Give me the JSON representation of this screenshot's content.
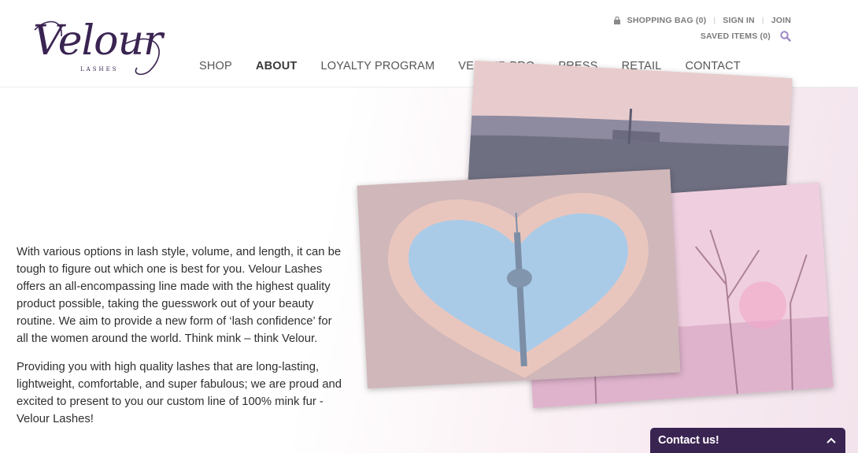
{
  "brand": {
    "logo_script": "Velour",
    "logo_sub": "LASHES",
    "color": "#3a2452"
  },
  "utility": {
    "shopping_bag": "SHOPPING BAG (0)",
    "sign_in": "SIGN IN",
    "join": "JOIN",
    "saved_items": "SAVED ITEMS (0)",
    "icons": [
      "lock-icon",
      "search-icon"
    ],
    "search_icon_color": "#9b86c4"
  },
  "nav": {
    "items": [
      {
        "label": "SHOP"
      },
      {
        "label": "ABOUT",
        "active": true
      },
      {
        "label": "LOYALTY PROGRAM"
      },
      {
        "label": "VELOUR PRO"
      },
      {
        "label": "PRESS"
      },
      {
        "label": "RETAIL"
      },
      {
        "label": "CONTACT"
      }
    ]
  },
  "content": {
    "paragraph_1": "With various options in lash style, volume, and length, it can be tough to figure out which one is best for you. Velour Lashes offers an all-encompassing line made with the highest quality product possible, taking the guesswork out of your beauty routine. We aim to provide a new form of ‘lash confidence’ for all the women around the world. Think mink – think Velour.",
    "paragraph_2": "Providing you with high quality lashes that are long-lasting, lightweight, comfortable, and super fabulous; we are proud and excited to present to you our custom line of 100% mink fur - Velour Lashes!"
  },
  "contact": {
    "label": "Contact us!",
    "icon": "chevron-up-icon"
  }
}
